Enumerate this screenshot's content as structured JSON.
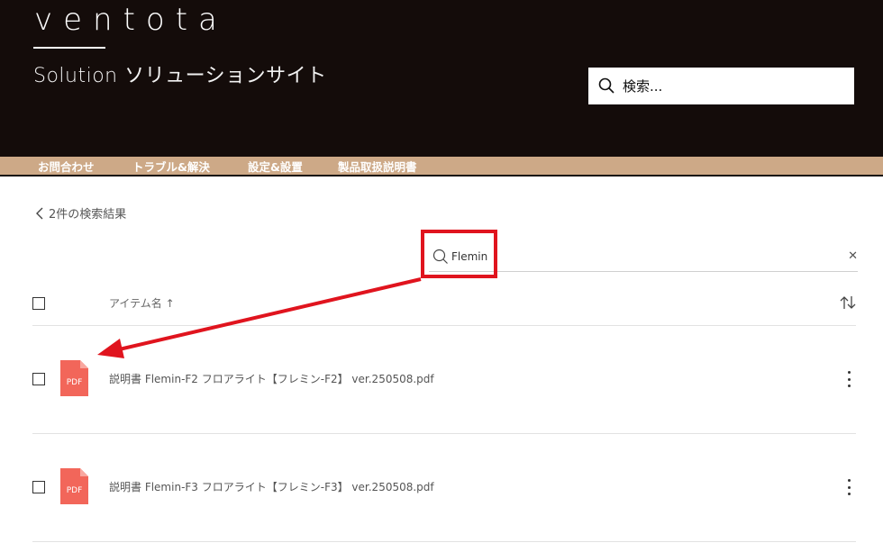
{
  "header": {
    "logo": "ventota",
    "subtitle": "Solution ソリューションサイト",
    "search": {
      "placeholder": "検索..."
    }
  },
  "nav": {
    "items": [
      "お問合わせ",
      "トラブル&解決",
      "設定&設置",
      "製品取扱説明書"
    ]
  },
  "results": {
    "back_label": "2件の検索結果",
    "query": "Flemin",
    "column_name": "アイテム名 ↑",
    "items": [
      {
        "name": "説明書 Flemin-F2 フロアライト【フレミン-F2】 ver.250508.pdf",
        "type": "PDF"
      },
      {
        "name": "説明書 Flemin-F3 フロアライト【フレミン-F3】 ver.250508.pdf",
        "type": "PDF"
      }
    ]
  },
  "colors": {
    "header_bg": "#140c0a",
    "nav_bg": "#cda987",
    "highlight": "#e0141e",
    "pdf": "#f2665a"
  }
}
